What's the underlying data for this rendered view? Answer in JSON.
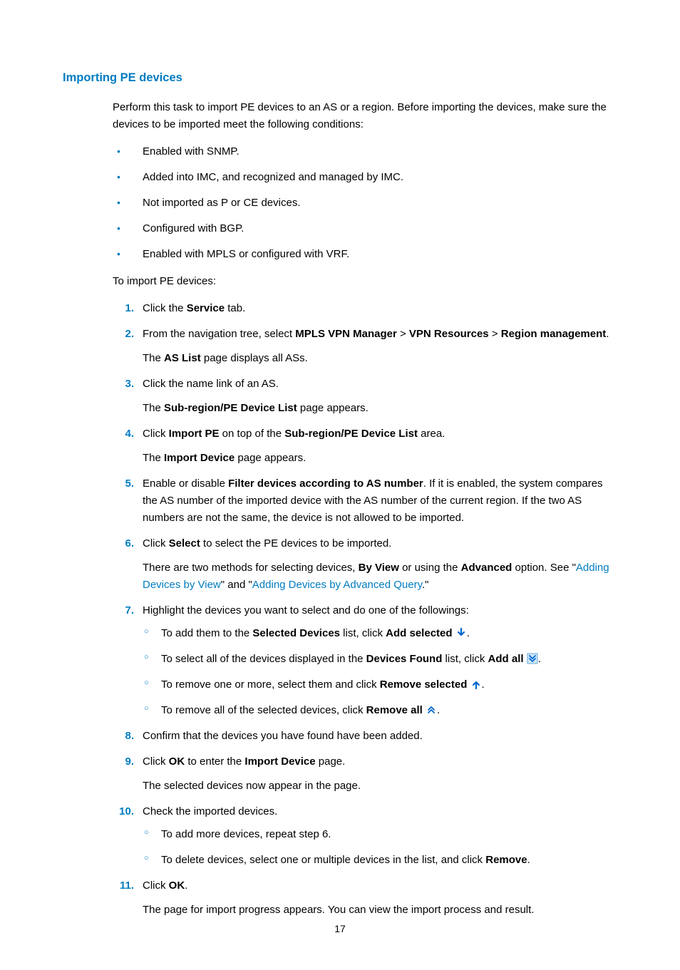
{
  "heading": "Importing PE devices",
  "intro": "Perform this task to import PE devices to an AS or a region. Before importing the devices, make sure the devices to be imported meet the following conditions:",
  "bullets": [
    "Enabled with SNMP.",
    "Added into IMC, and recognized and managed by IMC.",
    "Not imported as P or CE devices.",
    "Configured with BGP.",
    "Enabled with MPLS or configured with VRF."
  ],
  "leadin": "To import PE devices:",
  "step1": {
    "pre": "Click the ",
    "b1": "Service",
    "post": " tab."
  },
  "step2": {
    "pre": "From the navigation tree, select ",
    "b1": "MPLS VPN Manager",
    "gt1": " > ",
    "b2": "VPN Resources",
    "gt2": " > ",
    "b3": "Region management",
    "post": ".",
    "sub_pre": "The ",
    "sub_b": "AS List",
    "sub_post": " page displays all ASs."
  },
  "step3": {
    "text": "Click the name link of an AS.",
    "sub_pre": "The ",
    "sub_b": "Sub-region/PE Device List",
    "sub_post": " page appears."
  },
  "step4": {
    "pre": "Click ",
    "b1": "Import PE",
    "mid": " on top of the ",
    "b2": "Sub-region/PE Device List",
    "post": " area.",
    "sub_pre": "The ",
    "sub_b": "Import Device",
    "sub_post": " page appears."
  },
  "step5": {
    "pre": "Enable or disable ",
    "b1": "Filter devices according to AS number",
    "post": ". If it is enabled, the system compares the AS number of the imported device with the AS number of the current region. If the two AS numbers are not the same, the device is not allowed to be imported."
  },
  "step6": {
    "pre": "Click ",
    "b1": "Select",
    "post": " to select the PE devices to be imported.",
    "sub_pre": "There are two methods for selecting devices, ",
    "sub_b1": "By View",
    "sub_mid": " or using the ",
    "sub_b2": "Advanced",
    "sub_post": " option. See \"",
    "link1": "Adding Devices by View",
    "sub_and": "\" and \"",
    "link2": "Adding Devices by Advanced Query",
    "sub_end": ".\""
  },
  "step7": {
    "text": "Highlight the devices you want to select and do one of the followings:",
    "a": {
      "pre": "To add them to the ",
      "b1": "Selected Devices",
      "mid": " list, click ",
      "b2": "Add selected",
      "post": " "
    },
    "b": {
      "pre": "To select all of the devices displayed in the ",
      "b1": "Devices Found",
      "mid": " list, click ",
      "b2": "Add all",
      "post": " "
    },
    "c": {
      "pre": "To remove one or more, select them and click ",
      "b1": "Remove selected",
      "post": " "
    },
    "d": {
      "pre": "To remove all of the selected devices, click ",
      "b1": "Remove all",
      "post": " "
    },
    "period": "."
  },
  "step8": "Confirm that the devices you have found have been added.",
  "step9": {
    "pre": "Click ",
    "b1": "OK",
    "mid": " to enter the ",
    "b2": "Import Device",
    "post": " page.",
    "sub": "The selected devices now appear in the page."
  },
  "step10": {
    "text": "Check the imported devices.",
    "a": "To add more devices, repeat step 6.",
    "b": {
      "pre": "To delete devices, select one or multiple devices in the list, and click ",
      "b1": "Remove",
      "post": "."
    }
  },
  "step11": {
    "pre": "Click ",
    "b1": "OK",
    "post": ".",
    "sub": "The page for import progress appears. You can view the import process and result."
  },
  "page_number": "17"
}
